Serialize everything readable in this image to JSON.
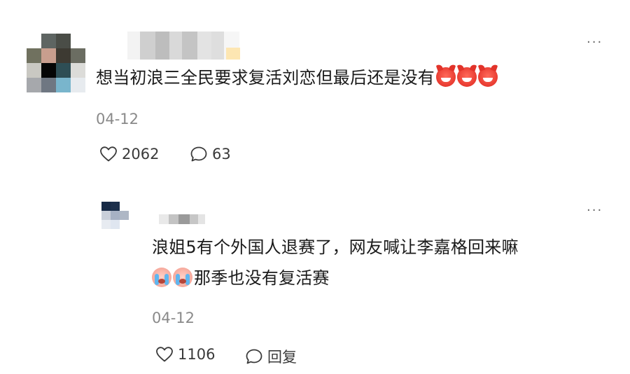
{
  "comment": {
    "text_main": "想当初浪三全民要求复活刘恋但最后还是没有",
    "emoji_count": 3,
    "date": "04-12",
    "likes": "2062",
    "replies": "63",
    "more": "···"
  },
  "reply": {
    "line1": "浪姐5有个外国人退赛了，网友喊让李嘉格回来嘛",
    "line2": "那季也没有复活赛",
    "date": "04-12",
    "likes": "1106",
    "reply_label": "回复",
    "more": "···"
  },
  "colors": {
    "text": "#1a1a1a",
    "secondary": "#8a8a8a",
    "icon": "#3a3a3a"
  }
}
